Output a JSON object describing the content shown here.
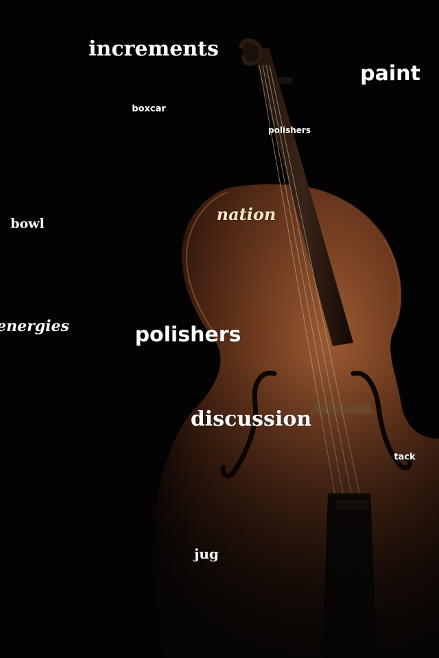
{
  "scene": {
    "subject": "cello",
    "background_color": "#030303",
    "wood_color": "#6b3a20",
    "highlight_color": "#b07040"
  },
  "words": {
    "increments": "increments",
    "paint": "paint",
    "boxcar": "boxcar",
    "polishers_small": "polishers",
    "nation": "nation",
    "bowl": "bowl",
    "energies": "energies",
    "polishers_large": "polishers",
    "discussion": "discussion",
    "tack": "tack",
    "jug": "jug"
  }
}
